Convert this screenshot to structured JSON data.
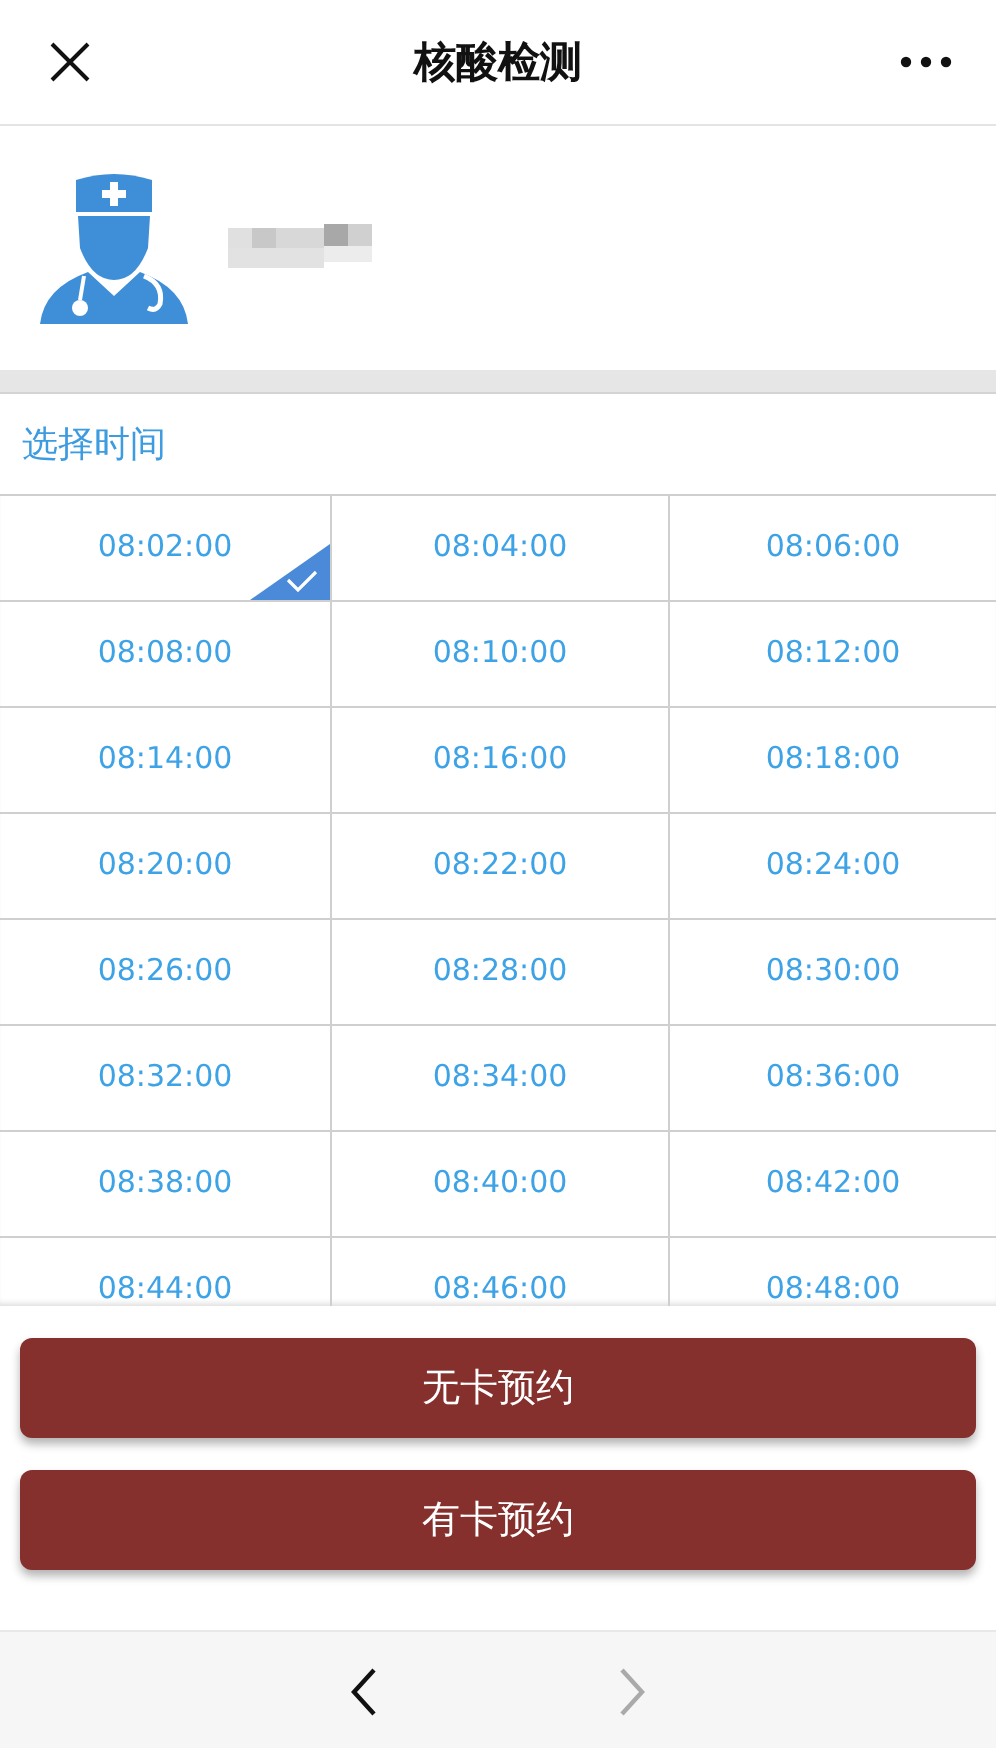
{
  "header": {
    "title": "核酸检测"
  },
  "section_label": "选择时间",
  "slots": [
    {
      "time": "08:02:00",
      "selected": true
    },
    {
      "time": "08:04:00",
      "selected": false
    },
    {
      "time": "08:06:00",
      "selected": false
    },
    {
      "time": "08:08:00",
      "selected": false
    },
    {
      "time": "08:10:00",
      "selected": false
    },
    {
      "time": "08:12:00",
      "selected": false
    },
    {
      "time": "08:14:00",
      "selected": false
    },
    {
      "time": "08:16:00",
      "selected": false
    },
    {
      "time": "08:18:00",
      "selected": false
    },
    {
      "time": "08:20:00",
      "selected": false
    },
    {
      "time": "08:22:00",
      "selected": false
    },
    {
      "time": "08:24:00",
      "selected": false
    },
    {
      "time": "08:26:00",
      "selected": false
    },
    {
      "time": "08:28:00",
      "selected": false
    },
    {
      "time": "08:30:00",
      "selected": false
    },
    {
      "time": "08:32:00",
      "selected": false
    },
    {
      "time": "08:34:00",
      "selected": false
    },
    {
      "time": "08:36:00",
      "selected": false
    },
    {
      "time": "08:38:00",
      "selected": false
    },
    {
      "time": "08:40:00",
      "selected": false
    },
    {
      "time": "08:42:00",
      "selected": false
    },
    {
      "time": "08:44:00",
      "selected": false
    },
    {
      "time": "08:46:00",
      "selected": false
    },
    {
      "time": "08:48:00",
      "selected": false
    }
  ],
  "buttons": [
    {
      "label": "无卡预约"
    },
    {
      "label": "有卡预约"
    }
  ],
  "nav": {
    "back_disabled": false,
    "forward_disabled": true
  }
}
